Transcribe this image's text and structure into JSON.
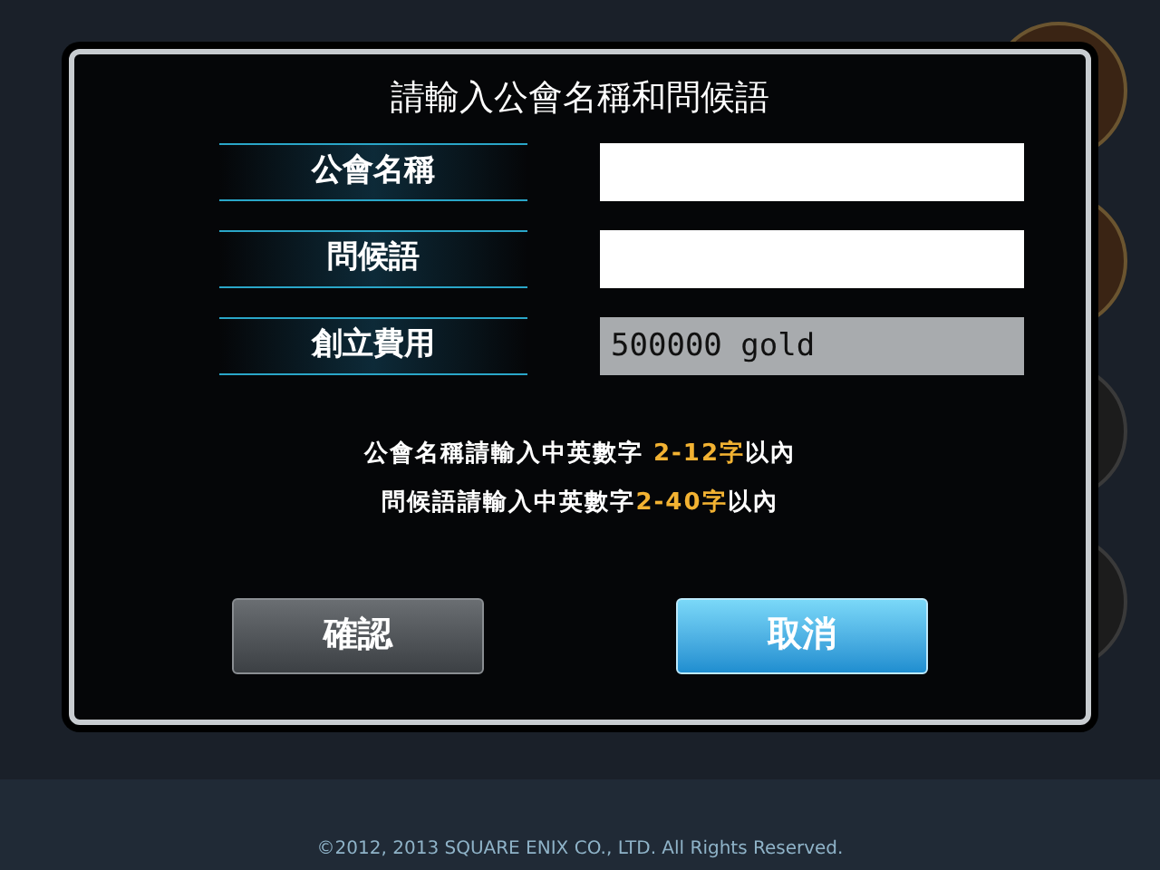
{
  "dialog": {
    "title": "請輸入公會名稱和問候語",
    "fields": [
      {
        "label": "公會名稱",
        "disabled": false
      },
      {
        "label": "問候語",
        "disabled": false
      },
      {
        "label": "創立費用",
        "value": "500000 gold",
        "disabled": true
      }
    ],
    "hints": [
      {
        "parts": [
          {
            "text": "公會名稱請輸入中英數字 ",
            "highlight": false
          },
          {
            "text": "2-12字",
            "highlight": true
          },
          {
            "text": "以內",
            "highlight": false
          }
        ]
      },
      {
        "parts": [
          {
            "text": "問候語請輸入中英數字",
            "highlight": false
          },
          {
            "text": "2-40字",
            "highlight": true
          },
          {
            "text": "以內",
            "highlight": false
          }
        ]
      }
    ],
    "buttons": [
      {
        "label": "確認",
        "kind": "secondary"
      },
      {
        "label": "取消",
        "kind": "primary"
      }
    ]
  },
  "footer": {
    "copyright": "©2012, 2013 SQUARE ENIX CO., LTD. All Rights Reserved."
  }
}
